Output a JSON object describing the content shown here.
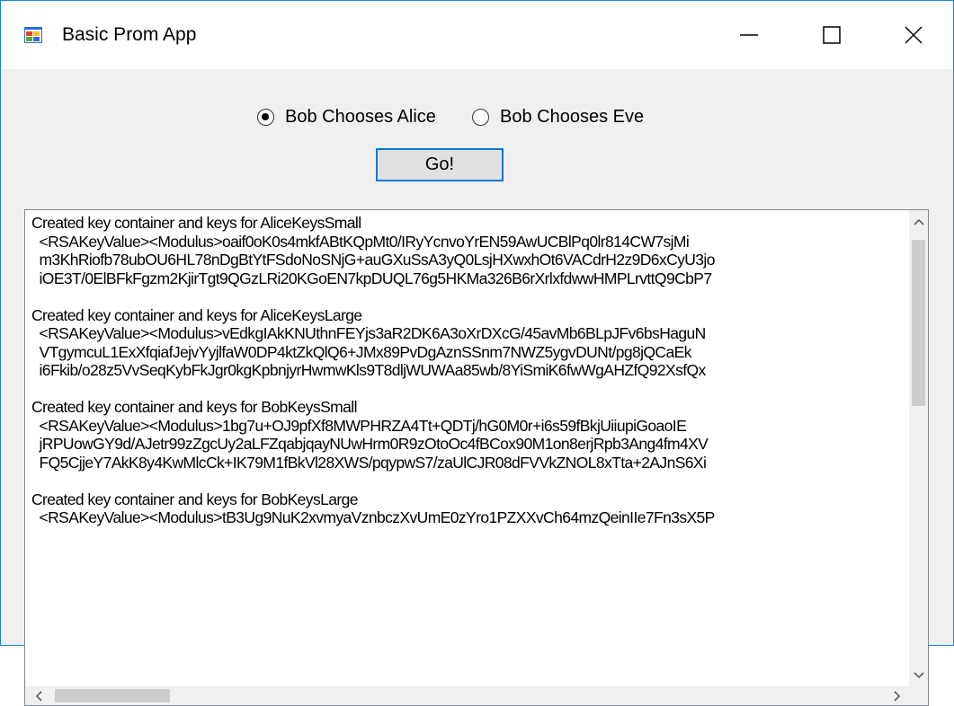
{
  "window": {
    "title": "Basic Prom App",
    "icon": "winforms-app-icon",
    "controls": {
      "minimize": "minimize-icon",
      "maximize": "maximize-icon",
      "close": "close-icon"
    }
  },
  "options": {
    "alice_label": "Bob Chooses Alice",
    "eve_label": "Bob Chooses Eve",
    "selected": "alice"
  },
  "go_button": {
    "label": "Go!"
  },
  "output": {
    "lines": [
      "Created key container and keys for AliceKeysSmall",
      "  <RSAKeyValue><Modulus>oaif0oK0s4mkfABtKQpMt0/IRyYcnvoYrEN59AwUCBlPq0lr814CW7sjMi",
      "  m3KhRiofb78ubOU6HL78nDgBtYtFSdoNoSNjG+auGXuSsA3yQ0LsjHXwxhOt6VACdrH2z9D6xCyU3jo",
      "  iOE3T/0ElBFkFgzm2KjirTgt9QGzLRi20KGoEN7kpDUQL76g5HKMa326B6rXrlxfdwwHMPLrvttQ9CbP7",
      "",
      "Created key container and keys for AliceKeysLarge",
      "  <RSAKeyValue><Modulus>vEdkgIAkKNUthnFEYjs3aR2DK6A3oXrDXcG/45avMb6BLpJFv6bsHaguN",
      "  VTgymcuL1ExXfqiafJejvYyjlfaW0DP4ktZkQlQ6+JMx89PvDgAznSSnm7NWZ5ygvDUNt/pg8jQCaEk",
      "  i6Fkib/o28z5VvSeqKybFkJgr0kgKpbnjyrHwmwKls9T8dljWUWAa85wb/8YiSmiK6fwWgAHZfQ92XsfQx",
      "",
      "Created key container and keys for BobKeysSmall",
      "  <RSAKeyValue><Modulus>1bg7u+OJ9pfXf8MWPHRZA4Tt+QDTj/hG0M0r+i6s59fBkjUiiupiGoaoIE",
      "  jRPUowGY9d/AJetr99zZgcUy2aLFZqabjqayNUwHrm0R9zOtoOc4fBCox90M1on8erjRpb3Ang4fm4XV",
      "  FQ5CjjeY7AkK8y4KwMlcCk+IK79M1fBkVl28XWS/pqypwS7/zaUlCJR08dFVVkZNOL8xTta+2AJnS6Xi",
      "",
      "Created key container and keys for BobKeysLarge",
      "  <RSAKeyValue><Modulus>tB3Ug9NuK2xvmyaVznbczXvUmE0zYro1PZXXvCh64mzQeinIIe7Fn3sX5P"
    ]
  },
  "scrollbars": {
    "vertical": {
      "up": "scroll-up-arrow-icon",
      "down": "scroll-down-arrow-icon"
    },
    "horizontal": {
      "left": "scroll-left-arrow-icon",
      "right": "scroll-right-arrow-icon"
    }
  },
  "colors": {
    "accent": "#0078d7",
    "window_border": "#1883d7",
    "client_bg": "#f0f0f0"
  }
}
